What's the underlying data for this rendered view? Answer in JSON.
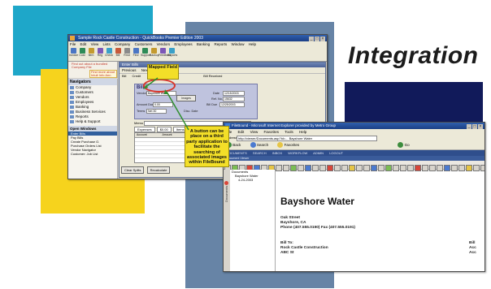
{
  "headline": "Integration",
  "qb": {
    "title": "Sample Rock Castle Construction - QuickBooks Premier Edition 2003",
    "menu": [
      "File",
      "Edit",
      "View",
      "Lists",
      "Company",
      "Customers",
      "Vendors",
      "Employees",
      "Banking",
      "Reports",
      "Window",
      "Help"
    ],
    "icons": [
      {
        "label": "Invoice",
        "color": "#4b76c4"
      },
      {
        "label": "Cust",
        "color": "#2e8b57"
      },
      {
        "label": "Item",
        "color": "#c49a2e"
      },
      {
        "label": "Reg",
        "color": "#7c57b8"
      },
      {
        "label": "Check",
        "color": "#3aa0c8"
      },
      {
        "label": "Bill",
        "color": "#c75a3a"
      },
      {
        "label": "Rmd",
        "color": "#8a8a8a"
      },
      {
        "label": "Find",
        "color": "#4b76c4"
      },
      {
        "label": "Support",
        "color": "#2e8b57"
      },
      {
        "label": "Backup",
        "color": "#c49a2e"
      },
      {
        "label": "Feedback",
        "color": "#7c57b8"
      },
      {
        "label": "Reports",
        "color": "#3aa0c8"
      }
    ],
    "promo_a": "Find out about a bundled Company File",
    "promo_b": "Find more about Intuit Info Ann",
    "navigators_title": "Navigators",
    "navigators": [
      "Company",
      "Customers",
      "Vendors",
      "Employees",
      "Banking",
      "Business Services",
      "Reports",
      "Help & Support"
    ],
    "open_windows_title": "Open Windows",
    "open_windows": [
      "Enter Bills",
      "Pay Bills",
      "Create Purchase O.",
      "Purchase Orders List",
      "Vendor Navigator",
      "Customer: Job List"
    ],
    "open_windows_selected": 0,
    "form": {
      "title": "Enter Bills",
      "tools": [
        "Previous",
        "Next",
        "Find",
        "History"
      ],
      "radios": [
        "Bill",
        "Credit"
      ],
      "checkbox": "Bill Received",
      "bill_title": "Bill",
      "vendor_label": "Vendor",
      "vendor_value": "Bayshore Water",
      "date_label": "Date",
      "date_value": "12/15/2003",
      "refno_label": "Ref. No.",
      "refno_value": "15632",
      "amount_due_label": "Amount Due",
      "amount_due_value": "0.00",
      "bill_due_label": "Bill Due",
      "bill_due_value": "12/25/2003",
      "terms_label": "Terms",
      "terms_value": "Net 30",
      "discount_label": "Disc. Date",
      "images_button": "Images",
      "memo_label": "Memo",
      "tabs": [
        "Expenses",
        "$0.00",
        "Items"
      ],
      "grid_headers": [
        "Account",
        "Amount",
        "Memo"
      ],
      "buttons": [
        "Clear Splits",
        "Recalculate"
      ],
      "right_buttons": [
        "Save & Close",
        "Save & New",
        "Clear"
      ]
    }
  },
  "callouts": {
    "mapped_field": "Mapped Field",
    "button_text": "A button can be place on a third party application to facilitate the searching of associated images within FileBound"
  },
  "browser": {
    "title": "FileBound - Microsoft Internet Explorer provided by Metro Group",
    "menu": [
      "File",
      "Edit",
      "View",
      "Favorites",
      "Tools",
      "Help"
    ],
    "address_label": "Address",
    "address_value": "http://viewer/Documents.asp?id=... Bayshore Water",
    "nav": [
      "Back",
      "Search",
      "Favorites",
      "Go"
    ],
    "fb_menu": [
      "DOCUMENTS",
      "SEARCH",
      "INBOX",
      "WORKFLOW",
      "ADMIN",
      "LOGOUT"
    ],
    "fb_sub": "Document Viewer",
    "sidetab": "Documents",
    "tree": [
      "Documents",
      "Bayshore Water",
      "4-24-2003"
    ],
    "doc": {
      "title": "Bayshore Water",
      "address_lines": [
        "Oak Street",
        "Bayshore, CA",
        "Phone (407.555.0190) Fax (407.555.0191)"
      ],
      "bill_to_lines": [
        "Bill To:",
        "Rock Castle Construction",
        "ABC St"
      ],
      "right_lines": [
        "Bill",
        "Acc",
        "Acc"
      ]
    }
  }
}
